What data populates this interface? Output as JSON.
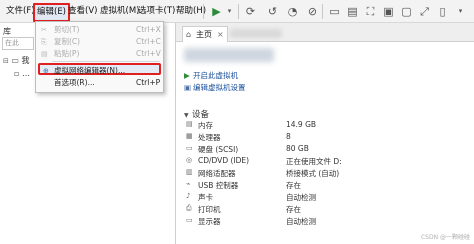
{
  "menubar": {
    "items": [
      "文件(F)",
      "编辑(E)",
      "查看(V)",
      "虚拟机(M)",
      "选项卡(T)",
      "帮助(H)"
    ]
  },
  "library": {
    "title": "库",
    "search_placeholder": "在此",
    "tree": [
      "我",
      "…"
    ]
  },
  "edit_menu": {
    "items": [
      {
        "label": "剪切(T)",
        "shortcut": "Ctrl+X",
        "disabled": true
      },
      {
        "label": "复制(C)",
        "shortcut": "Ctrl+C",
        "disabled": true
      },
      {
        "label": "粘贴(P)",
        "shortcut": "Ctrl+V",
        "disabled": true
      },
      {
        "label": "虚拟网络编辑器(N)...",
        "shortcut": "",
        "disabled": false,
        "highlighted": true
      },
      {
        "label": "首选项(R)...",
        "shortcut": "Ctrl+P",
        "disabled": false
      }
    ]
  },
  "tabs": {
    "home": "主页",
    "close": "×"
  },
  "actions": [
    "开启此虚拟机",
    "编辑虚拟机设置"
  ],
  "devices": {
    "title": "设备",
    "rows": [
      {
        "name": "内存",
        "value": "14.9 GB",
        "icon": "memory-icon"
      },
      {
        "name": "处理器",
        "value": "8",
        "icon": "cpu-icon"
      },
      {
        "name": "硬盘 (SCSI)",
        "value": "80 GB",
        "icon": "disk-icon"
      },
      {
        "name": "CD/DVD (IDE)",
        "value": "正在使用文件 D:",
        "icon": "cd-icon"
      },
      {
        "name": "网络适配器",
        "value": "桥接模式 (自动)",
        "icon": "network-icon"
      },
      {
        "name": "USB 控制器",
        "value": "存在",
        "icon": "usb-icon"
      },
      {
        "name": "声卡",
        "value": "自动检测",
        "icon": "sound-icon"
      },
      {
        "name": "打印机",
        "value": "存在",
        "icon": "printer-icon"
      },
      {
        "name": "显示器",
        "value": "自动检测",
        "icon": "display-icon"
      }
    ]
  },
  "watermark": "CSDN @一颗碰碰",
  "colors": {
    "highlight_border": "#e02020",
    "link": "#1a4f9c",
    "play_green": "#2e8b3a"
  }
}
